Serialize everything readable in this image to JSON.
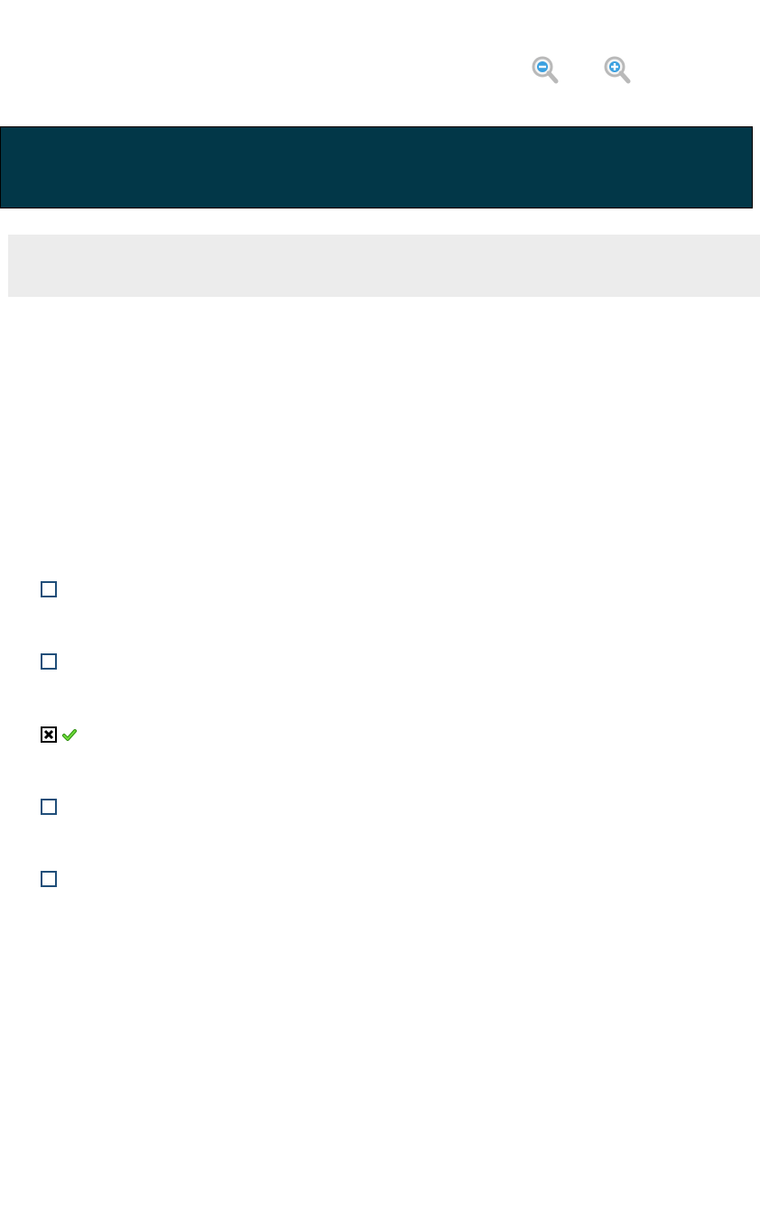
{
  "toolbar": {
    "zoom_out_icon": "zoom-out-icon",
    "zoom_in_icon": "zoom-in-icon"
  },
  "colors": {
    "header_background": "#023748",
    "info_bar_background": "#ececec",
    "checkbox_border": "#1f4e79",
    "correct_mark": "#4cc11a",
    "zoom_icon_accent": "#3aa0e0"
  },
  "answers": [
    {
      "checked": false,
      "correct_icon": false
    },
    {
      "checked": false,
      "correct_icon": false
    },
    {
      "checked": true,
      "correct_icon": true
    },
    {
      "checked": false,
      "correct_icon": false
    },
    {
      "checked": false,
      "correct_icon": false
    }
  ]
}
